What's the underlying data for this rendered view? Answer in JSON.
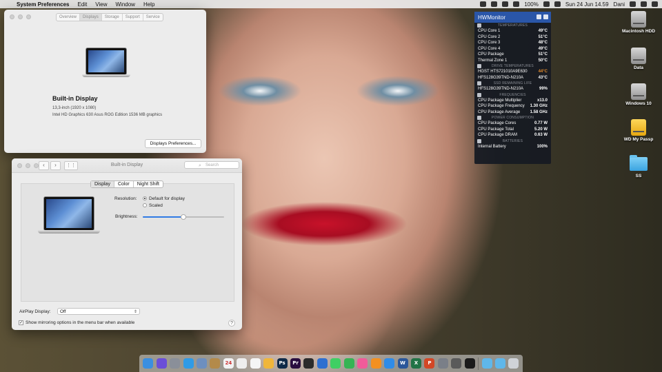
{
  "menubar": {
    "app_name": "System Preferences",
    "items": [
      "Edit",
      "View",
      "Window",
      "Help"
    ],
    "battery": "100%",
    "datetime": "Sun 24 Jun  14.59",
    "user": "Dani"
  },
  "about_window": {
    "tabs": [
      "Overview",
      "Displays",
      "Storage",
      "Support",
      "Service"
    ],
    "selected_tab": "Displays",
    "model": "Built-in Display",
    "resolution": "13,3-inch (1920 x 1080)",
    "graphics": "Intel HD Graphics 630 Asus ROG Edition 1536 MB graphics",
    "button": "Displays Preferences..."
  },
  "display_prefs": {
    "title": "Built-in Display",
    "search_placeholder": "Search",
    "tabs": [
      "Display",
      "Color",
      "Night Shift"
    ],
    "selected_tab": "Display",
    "resolution_label": "Resolution:",
    "resolution_options": [
      "Default for display",
      "Scaled"
    ],
    "resolution_selected": "Default for display",
    "brightness_label": "Brightness:",
    "brightness_level": 0.5,
    "airplay_label": "AirPlay Display:",
    "airplay_value": "Off",
    "mirroring_label": "Show mirroring options in the menu bar when available",
    "mirroring_checked": true,
    "help": "?"
  },
  "hwmonitor": {
    "title": "HWMonitor",
    "sections": [
      {
        "name": "TEMPERATURES",
        "rows": [
          {
            "label": "CPU Core 1",
            "value": "49°C"
          },
          {
            "label": "CPU Core 2",
            "value": "51°C"
          },
          {
            "label": "CPU Core 3",
            "value": "48°C"
          },
          {
            "label": "CPU Core 4",
            "value": "49°C"
          },
          {
            "label": "CPU Package",
            "value": "51°C"
          },
          {
            "label": "Thermal Zone 1",
            "value": "50°C"
          }
        ]
      },
      {
        "name": "DRIVE TEMPERATURES",
        "rows": [
          {
            "label": "HGST HTS721010A9E630",
            "value": "44°C",
            "warn": true
          },
          {
            "label": "HFS128G39TND-N210A",
            "value": "43°C"
          }
        ]
      },
      {
        "name": "SSD REMAINING LIFE",
        "rows": [
          {
            "label": "HFS128G39TND-N210A",
            "value": "99%"
          }
        ]
      },
      {
        "name": "FREQUENCIES",
        "rows": [
          {
            "label": "CPU Package Multiplier",
            "value": "x13.0"
          },
          {
            "label": "CPU Package Frequency",
            "value": "1.30 GHz"
          },
          {
            "label": "CPU Package Average",
            "value": "1.58 GHz"
          }
        ]
      },
      {
        "name": "POWER CONSUMPTION",
        "rows": [
          {
            "label": "CPU Package Cores",
            "value": "0.77 W"
          },
          {
            "label": "CPU Package Total",
            "value": "5.20 W"
          },
          {
            "label": "CPU Package DRAM",
            "value": "0.63 W"
          }
        ]
      },
      {
        "name": "BATTERIES",
        "rows": [
          {
            "label": "Internal Battery",
            "value": "100%"
          }
        ]
      }
    ]
  },
  "desktop_icons": [
    {
      "label": "Macintosh HDD",
      "type": "drive"
    },
    {
      "label": "Data",
      "type": "drive"
    },
    {
      "label": "Windows 10",
      "type": "drive"
    },
    {
      "label": "WD My Passp",
      "type": "drive-yellow"
    },
    {
      "label": "SS",
      "type": "folder"
    }
  ],
  "dock": {
    "apps": [
      {
        "name": "finder-icon",
        "color": "#3b8fe0",
        "glyph": ""
      },
      {
        "name": "siri-icon",
        "color": "#6b4fd8",
        "glyph": ""
      },
      {
        "name": "launchpad-icon",
        "color": "#8a8f99",
        "glyph": ""
      },
      {
        "name": "safari-icon",
        "color": "#2f9be6",
        "glyph": ""
      },
      {
        "name": "preview-icon",
        "color": "#6d8fbf",
        "glyph": ""
      },
      {
        "name": "notes-icon",
        "color": "#b38a4a",
        "glyph": ""
      },
      {
        "name": "calendar-icon",
        "color": "#f2f2f2",
        "glyph": "24"
      },
      {
        "name": "textedit-icon",
        "color": "#eeeeee",
        "glyph": ""
      },
      {
        "name": "reminders-icon",
        "color": "#f5f5f5",
        "glyph": ""
      },
      {
        "name": "photos-icon",
        "color": "#f0b63a",
        "glyph": ""
      },
      {
        "name": "photoshop-icon",
        "color": "#0f2a48",
        "glyph": "Ps"
      },
      {
        "name": "premiere-icon",
        "color": "#2a0d3f",
        "glyph": "Pr"
      },
      {
        "name": "final-cut-icon",
        "color": "#2b2b2b",
        "glyph": ""
      },
      {
        "name": "keynote-icon",
        "color": "#2e6fd0",
        "glyph": ""
      },
      {
        "name": "messages-icon",
        "color": "#3fcf63",
        "glyph": ""
      },
      {
        "name": "facetime-icon",
        "color": "#35b454",
        "glyph": ""
      },
      {
        "name": "itunes-icon",
        "color": "#f05b9a",
        "glyph": ""
      },
      {
        "name": "ibooks-icon",
        "color": "#f39021",
        "glyph": ""
      },
      {
        "name": "app-store-icon",
        "color": "#2f8ce8",
        "glyph": ""
      },
      {
        "name": "word-icon",
        "color": "#2b579a",
        "glyph": "W"
      },
      {
        "name": "excel-icon",
        "color": "#217346",
        "glyph": "X"
      },
      {
        "name": "powerpoint-icon",
        "color": "#d24726",
        "glyph": "P"
      },
      {
        "name": "system-preferences-icon",
        "color": "#7a7f88",
        "glyph": ""
      },
      {
        "name": "activity-monitor-icon",
        "color": "#5a5a5a",
        "glyph": ""
      },
      {
        "name": "terminal-icon",
        "color": "#1b1b1b",
        "glyph": ""
      }
    ],
    "stacks": [
      {
        "name": "downloads-folder-icon",
        "color": "#5fb7ea"
      },
      {
        "name": "documents-folder-icon",
        "color": "#5fb7ea"
      },
      {
        "name": "trash-icon",
        "color": "#cfd3d8"
      }
    ]
  }
}
